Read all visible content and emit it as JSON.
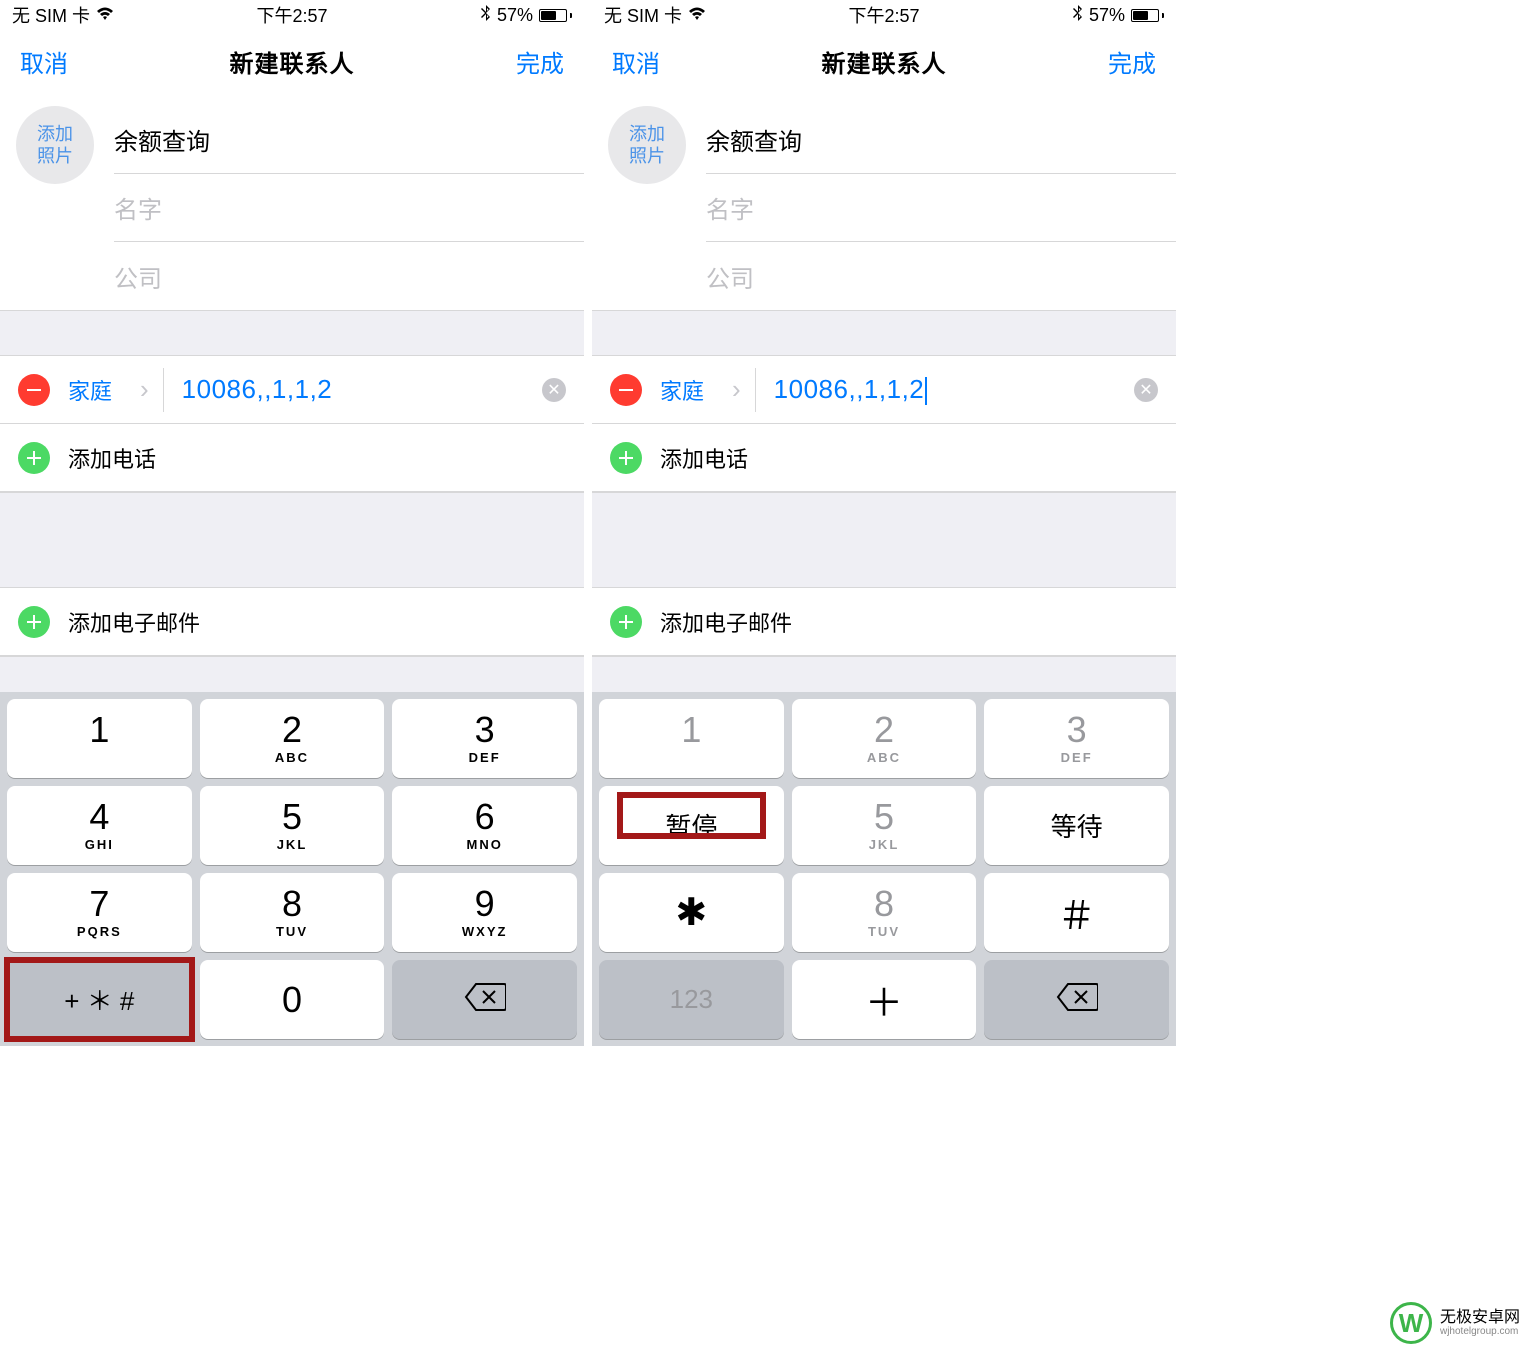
{
  "status": {
    "carrier": "无 SIM 卡",
    "wifi_icon": "wifi",
    "time": "下午2:57",
    "bluetooth_icon": "bluetooth",
    "battery_pct": "57%"
  },
  "nav": {
    "cancel": "取消",
    "title": "新建联系人",
    "done": "完成"
  },
  "photo": {
    "line1": "添加",
    "line2": "照片"
  },
  "fields": {
    "last_name_value": "余额查询",
    "first_name_placeholder": "名字",
    "company_placeholder": "公司"
  },
  "phone": {
    "type_label": "家庭",
    "value": "10086,,1,1,2",
    "add_phone_label": "添加电话",
    "add_email_label": "添加电子邮件"
  },
  "keypad_numeric": {
    "k1": {
      "num": "1",
      "sub": ""
    },
    "k2": {
      "num": "2",
      "sub": "ABC"
    },
    "k3": {
      "num": "3",
      "sub": "DEF"
    },
    "k4": {
      "num": "4",
      "sub": "GHI"
    },
    "k5": {
      "num": "5",
      "sub": "JKL"
    },
    "k6": {
      "num": "6",
      "sub": "MNO"
    },
    "k7": {
      "num": "7",
      "sub": "PQRS"
    },
    "k8": {
      "num": "8",
      "sub": "TUV"
    },
    "k9": {
      "num": "9",
      "sub": "WXYZ"
    },
    "sym": "+ ＊ #",
    "k0": {
      "num": "0",
      "sub": ""
    }
  },
  "keypad_symbol": {
    "k1": {
      "num": "1",
      "sub": ""
    },
    "k2": {
      "num": "2",
      "sub": "ABC"
    },
    "k3": {
      "num": "3",
      "sub": "DEF"
    },
    "pause": "暂停",
    "k5": {
      "num": "5",
      "sub": "JKL"
    },
    "wait": "等待",
    "star": "✱",
    "k8": {
      "num": "8",
      "sub": "TUV"
    },
    "hash": "＃",
    "back_label": "123",
    "plus": "＋"
  },
  "watermark": {
    "logo_letter": "W",
    "line1": "无极安卓网",
    "line2": "wjhotelgroup.com"
  }
}
